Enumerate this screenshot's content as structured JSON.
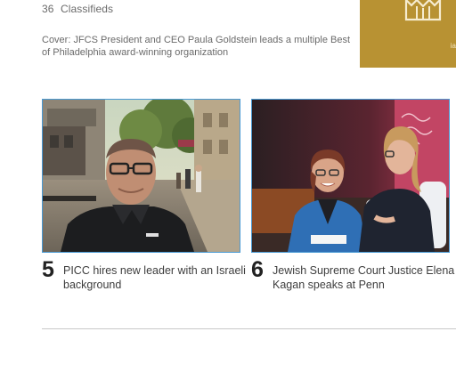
{
  "header": {
    "page_number": "36",
    "section": "Classifieds"
  },
  "cover_note": "Cover: JFCS President and CEO Paula Goldstein leads a multiple Best of Philadelphia award-winning organization",
  "cover_thumb": {
    "fragment_text": "ia"
  },
  "stories": [
    {
      "number": "5",
      "headline": "PICC hires new leader with an Israeli background"
    },
    {
      "number": "6",
      "headline": "Jewish Supreme Court Justice Elena Kagan speaks at Penn"
    }
  ],
  "colors": {
    "cover_gold": "#b89233",
    "photo_border": "#4a9ad4"
  }
}
